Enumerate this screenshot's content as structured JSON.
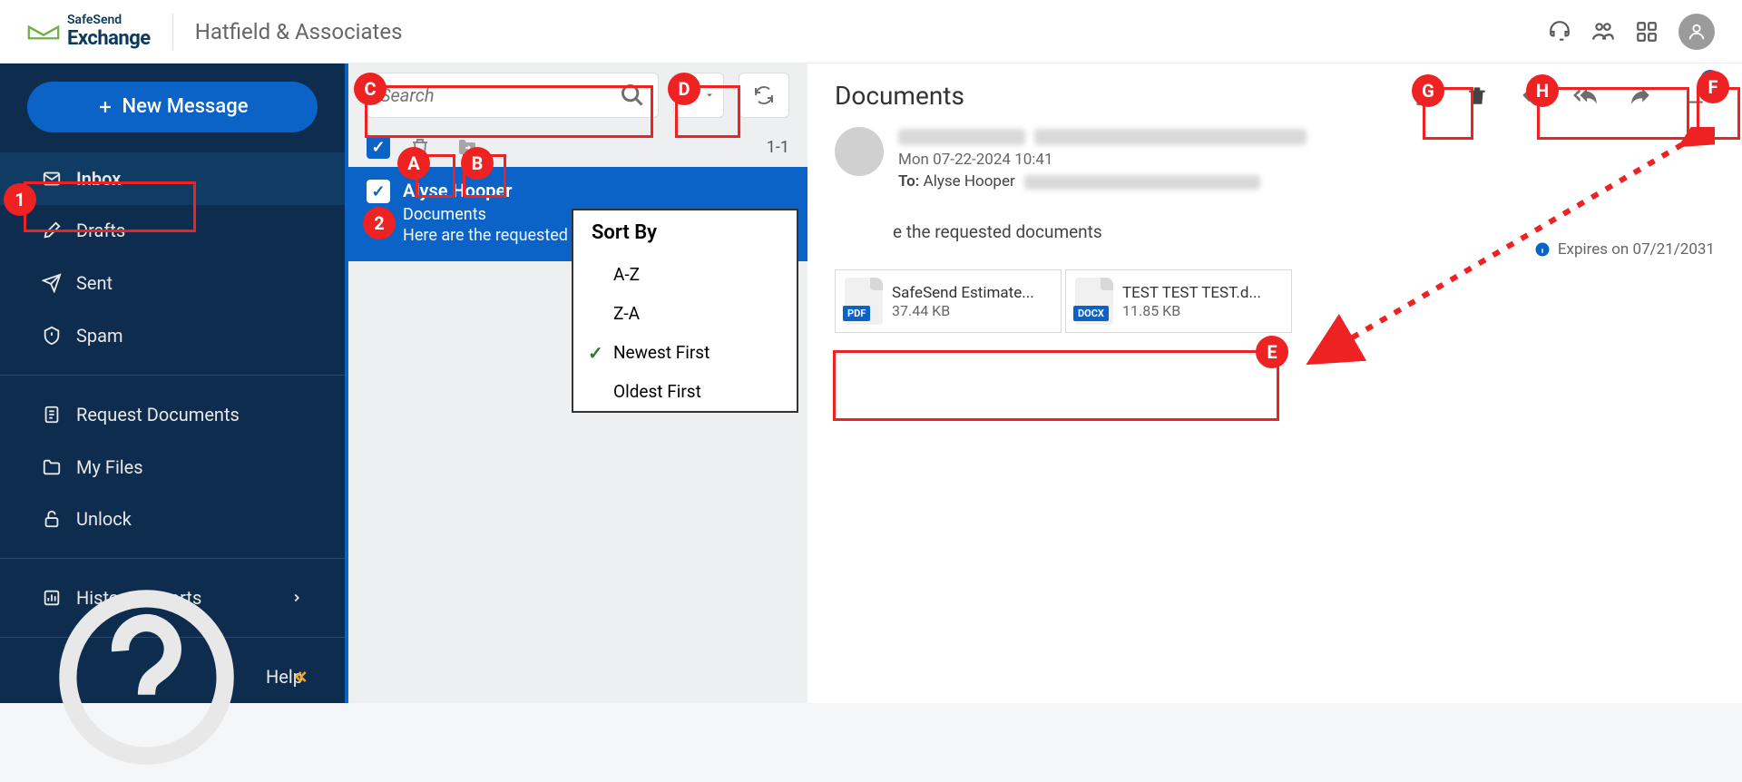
{
  "header": {
    "logo_top": "SafeSend",
    "logo_bottom": "Exchange",
    "org_name": "Hatfield & Associates"
  },
  "sidebar": {
    "new_message": "New Message",
    "items": [
      {
        "label": "Inbox"
      },
      {
        "label": "Drafts"
      },
      {
        "label": "Sent"
      },
      {
        "label": "Spam"
      },
      {
        "label": "Request Documents"
      },
      {
        "label": "My Files"
      },
      {
        "label": "Unlock"
      },
      {
        "label": "History Reports"
      }
    ],
    "help": "Help"
  },
  "list": {
    "search_placeholder": "Search",
    "page_indicator": "1-1",
    "message": {
      "sender": "Alyse Hooper",
      "subject": "Documents",
      "preview": "Here are the requested documents"
    }
  },
  "sort_menu": {
    "title": "Sort By",
    "options": [
      "A-Z",
      "Z-A",
      "Newest First",
      "Oldest First"
    ],
    "selected": "Newest First"
  },
  "content": {
    "title": "Documents",
    "date": "Mon 07-22-2024 10:41",
    "to_label": "To:",
    "to_value": "Alyse Hooper",
    "expires_label": "Expires on 07/21/2031",
    "body_text": "e the requested documents",
    "download_count": "2",
    "attachments": [
      {
        "name": "SafeSend Estimate...",
        "size": "37.44 KB",
        "type": "PDF",
        "color": "#0b62c7"
      },
      {
        "name": "TEST TEST TEST.d...",
        "size": "11.85 KB",
        "type": "DOCX",
        "color": "#0b62c7"
      }
    ]
  },
  "callouts": {
    "c1": "1",
    "c2": "2",
    "cA": "A",
    "cB": "B",
    "cC": "C",
    "cD": "D",
    "cE": "E",
    "cF": "F",
    "cG": "G",
    "cH": "H"
  }
}
